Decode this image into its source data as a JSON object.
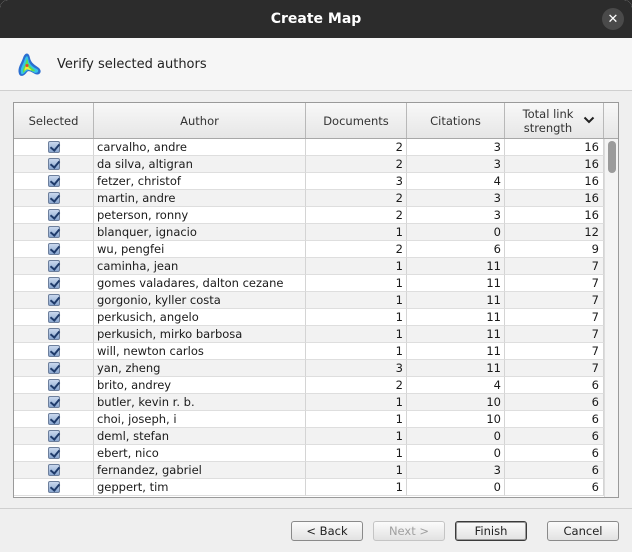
{
  "window": {
    "title": "Create Map",
    "close_glyph": "✕"
  },
  "header": {
    "text": "Verify selected authors",
    "icon": "vosviewer-logo-icon"
  },
  "table": {
    "columns": [
      "Selected",
      "Author",
      "Documents",
      "Citations",
      "Total link strength"
    ],
    "sort_column": "Total link strength",
    "sort_direction": "descending",
    "rows": [
      {
        "selected": true,
        "author": "carvalho, andre",
        "documents": "2",
        "citations": "3",
        "tls": "16"
      },
      {
        "selected": true,
        "author": "da silva, altigran",
        "documents": "2",
        "citations": "3",
        "tls": "16"
      },
      {
        "selected": true,
        "author": "fetzer, christof",
        "documents": "3",
        "citations": "4",
        "tls": "16"
      },
      {
        "selected": true,
        "author": "martin, andre",
        "documents": "2",
        "citations": "3",
        "tls": "16"
      },
      {
        "selected": true,
        "author": "peterson, ronny",
        "documents": "2",
        "citations": "3",
        "tls": "16"
      },
      {
        "selected": true,
        "author": "blanquer, ignacio",
        "documents": "1",
        "citations": "0",
        "tls": "12"
      },
      {
        "selected": true,
        "author": "wu, pengfei",
        "documents": "2",
        "citations": "6",
        "tls": "9"
      },
      {
        "selected": true,
        "author": "caminha, jean",
        "documents": "1",
        "citations": "11",
        "tls": "7"
      },
      {
        "selected": true,
        "author": "gomes valadares, dalton cezane",
        "documents": "1",
        "citations": "11",
        "tls": "7"
      },
      {
        "selected": true,
        "author": "gorgonio, kyller costa",
        "documents": "1",
        "citations": "11",
        "tls": "7"
      },
      {
        "selected": true,
        "author": "perkusich, angelo",
        "documents": "1",
        "citations": "11",
        "tls": "7"
      },
      {
        "selected": true,
        "author": "perkusich, mirko barbosa",
        "documents": "1",
        "citations": "11",
        "tls": "7"
      },
      {
        "selected": true,
        "author": "will, newton carlos",
        "documents": "1",
        "citations": "11",
        "tls": "7"
      },
      {
        "selected": true,
        "author": "yan, zheng",
        "documents": "3",
        "citations": "11",
        "tls": "7"
      },
      {
        "selected": true,
        "author": "brito, andrey",
        "documents": "2",
        "citations": "4",
        "tls": "6"
      },
      {
        "selected": true,
        "author": "butler, kevin r. b.",
        "documents": "1",
        "citations": "10",
        "tls": "6"
      },
      {
        "selected": true,
        "author": "choi, joseph, i",
        "documents": "1",
        "citations": "10",
        "tls": "6"
      },
      {
        "selected": true,
        "author": "deml, stefan",
        "documents": "1",
        "citations": "0",
        "tls": "6"
      },
      {
        "selected": true,
        "author": "ebert, nico",
        "documents": "1",
        "citations": "0",
        "tls": "6"
      },
      {
        "selected": true,
        "author": "fernandez, gabriel",
        "documents": "1",
        "citations": "3",
        "tls": "6"
      },
      {
        "selected": true,
        "author": "geppert, tim",
        "documents": "1",
        "citations": "0",
        "tls": "6"
      }
    ]
  },
  "buttons": {
    "back": "< Back",
    "next": "Next >",
    "finish": "Finish",
    "cancel": "Cancel"
  }
}
